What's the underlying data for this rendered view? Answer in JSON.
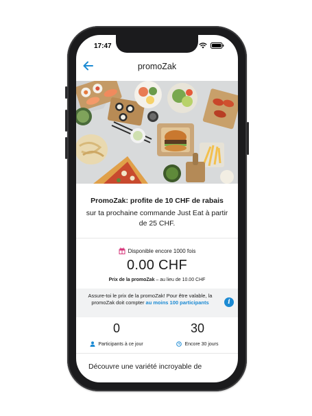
{
  "status_bar": {
    "time": "17:47"
  },
  "nav": {
    "title": "promoZak"
  },
  "offer": {
    "title": "PromoZak: profite de 10 CHF de rabais",
    "subtitle": "sur ta prochaine commande Just Eat à partir de 25 CHF."
  },
  "availability": {
    "label": "Disponible encore 1000 fois"
  },
  "price": {
    "value": "0.00 CHF",
    "note_prefix": "Prix de la promoZak",
    "note_suffix": " – au lieu de 10.00 CHF"
  },
  "info": {
    "text": "Assure-toi le prix de la promoZak! Pour être valable, la promoZak doit compter ",
    "link": "au moins 100 participants"
  },
  "stats": {
    "participants": {
      "value": "0",
      "label": "Participants à ce jour"
    },
    "days": {
      "value": "30",
      "label": "Encore 30 jours"
    }
  },
  "discover": {
    "text": "Découvre une variété incroyable de"
  },
  "icons": {
    "back": "back-arrow-icon",
    "signal": "signal-icon",
    "wifi": "wifi-icon",
    "battery": "battery-icon",
    "gift": "gift-icon",
    "info": "info-icon",
    "person": "person-icon",
    "clock": "clock-icon"
  },
  "colors": {
    "accent": "#1b8ad3",
    "gift": "#d6357a",
    "info_bg": "#f1f2f3"
  }
}
